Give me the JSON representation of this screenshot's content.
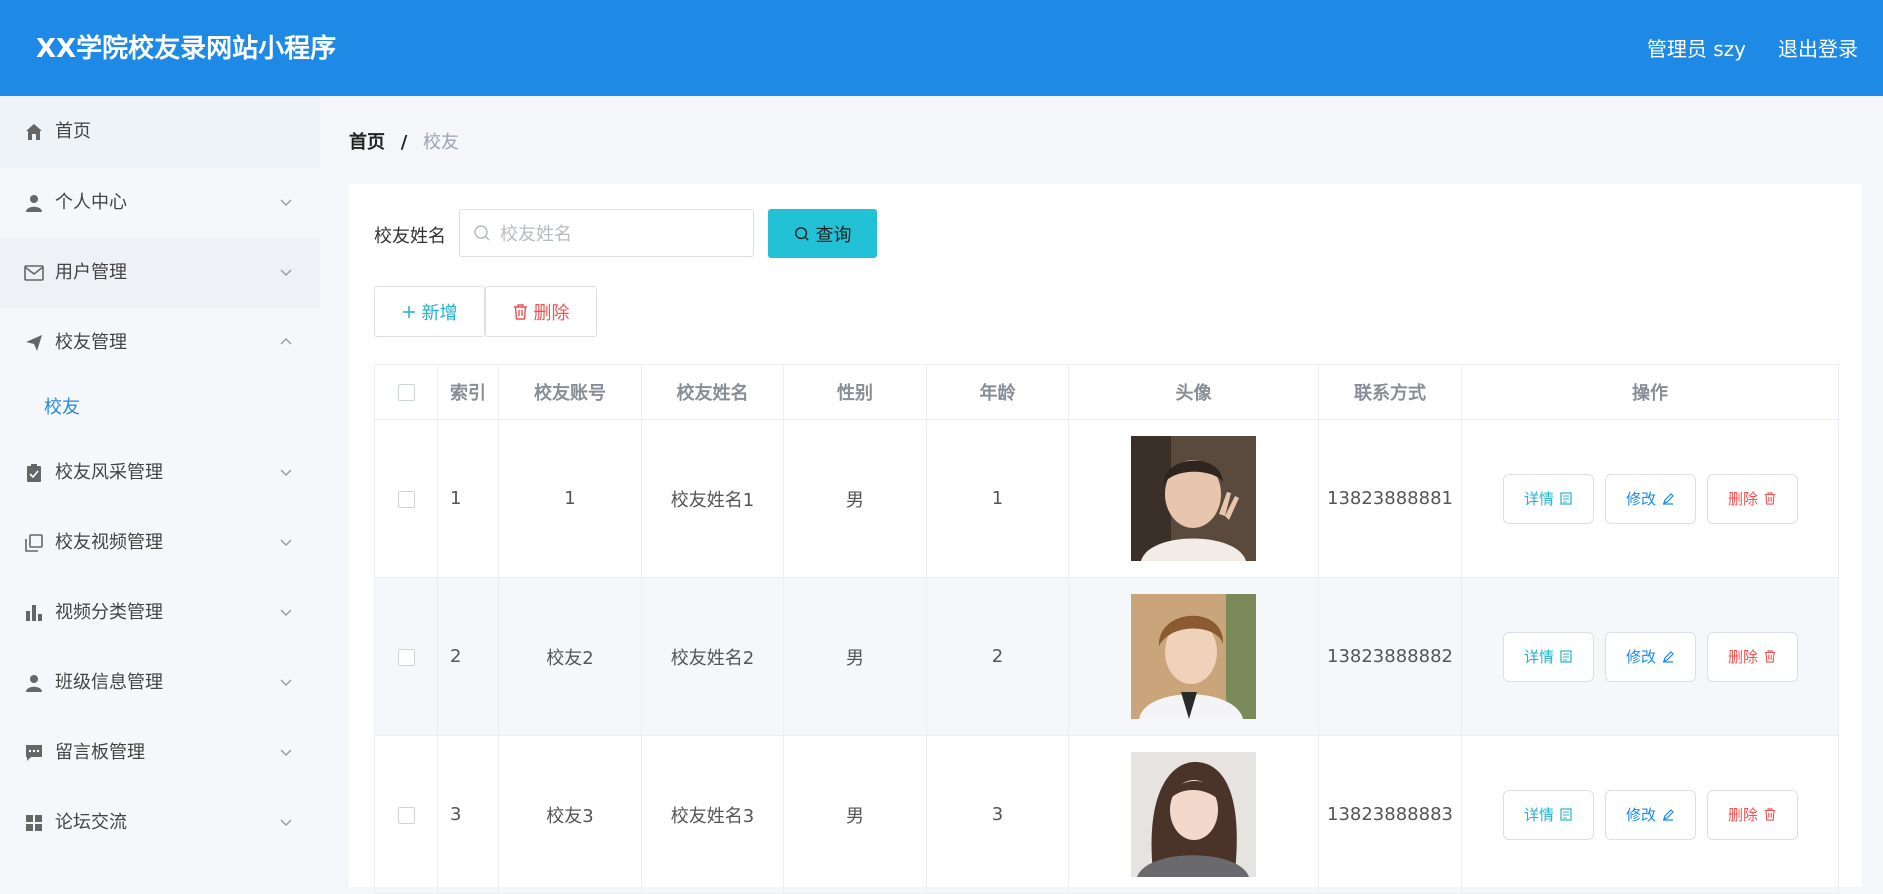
{
  "header": {
    "title": "XX学院校友录网站小程序",
    "admin_label": "管理员 szy",
    "logout_label": "退出登录"
  },
  "sidebar": {
    "items": [
      {
        "label": "首页",
        "icon": "home-icon"
      },
      {
        "label": "个人中心",
        "icon": "user-icon"
      },
      {
        "label": "用户管理",
        "icon": "mail-icon"
      },
      {
        "label": "校友管理",
        "icon": "send-icon"
      },
      {
        "label": "校友风采管理",
        "icon": "clipboard-icon"
      },
      {
        "label": "校友视频管理",
        "icon": "copy-icon"
      },
      {
        "label": "视频分类管理",
        "icon": "bar-chart-icon"
      },
      {
        "label": "班级信息管理",
        "icon": "user-icon"
      },
      {
        "label": "留言板管理",
        "icon": "message-icon"
      },
      {
        "label": "论坛交流",
        "icon": "grid-icon"
      }
    ],
    "submenu": {
      "label": "校友"
    }
  },
  "breadcrumb": {
    "home": "首页",
    "separator": "/",
    "current": "校友"
  },
  "search": {
    "label": "校友姓名",
    "placeholder": "校友姓名",
    "value": "",
    "button_label": "查询"
  },
  "actions": {
    "add_label": "新增",
    "delete_label": "删除"
  },
  "table": {
    "headers": [
      "索引",
      "校友账号",
      "校友姓名",
      "性别",
      "年龄",
      "头像",
      "联系方式",
      "操作"
    ],
    "rows": [
      {
        "index": "1",
        "account": "1",
        "name": "校友姓名1",
        "gender": "男",
        "age": "1",
        "phone": "13823888881"
      },
      {
        "index": "2",
        "account": "校友2",
        "name": "校友姓名2",
        "gender": "男",
        "age": "2",
        "phone": "13823888882"
      },
      {
        "index": "3",
        "account": "校友3",
        "name": "校友姓名3",
        "gender": "男",
        "age": "3",
        "phone": "13823888883"
      }
    ],
    "op_labels": {
      "detail": "详情",
      "edit": "修改",
      "delete": "删除"
    }
  },
  "colors": {
    "header_bg": "#1f8ae5",
    "query_button": "#22c1d6",
    "detail": "#22b3cc",
    "edit": "#1f8ae5",
    "danger": "#f05050"
  }
}
